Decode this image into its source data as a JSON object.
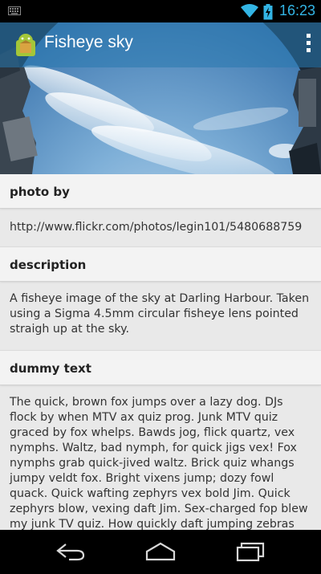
{
  "status_bar": {
    "time": "16:23",
    "icons": [
      "keyboard-icon",
      "wifi-icon",
      "battery-charging-icon"
    ],
    "accent_color": "#33b5e5"
  },
  "action_bar": {
    "title": "Fisheye sky",
    "app_icon": "android-app-icon",
    "overflow_icon": "overflow-menu-icon"
  },
  "sections": [
    {
      "header": "photo by",
      "body": "http://www.flickr.com/photos/legin101/5480688759"
    },
    {
      "header": "description",
      "body": "A fisheye image of the sky at Darling Harbour. Taken using a Sigma 4.5mm circular fisheye lens pointed straigh up at the sky."
    },
    {
      "header": "dummy text",
      "body": "The quick, brown fox jumps over a lazy dog. DJs flock by when MTV ax quiz prog. Junk MTV quiz graced by fox whelps. Bawds jog, flick quartz, vex nymphs. Waltz, bad nymph, for quick jigs vex! Fox nymphs grab quick-jived waltz. Brick quiz whangs jumpy veldt fox. Bright vixens jump; dozy fowl quack. Quick wafting zephyrs vex bold Jim. Quick zephyrs blow, vexing daft Jim. Sex-charged fop blew my junk TV quiz. How quickly daft jumping zebras vex. Two driven jocks help fax my big quiz. Quick, Baz, get my woven flax jodhpurs!"
    }
  ],
  "nav_bar": {
    "icons": [
      "back-icon",
      "home-icon",
      "recents-icon"
    ]
  }
}
